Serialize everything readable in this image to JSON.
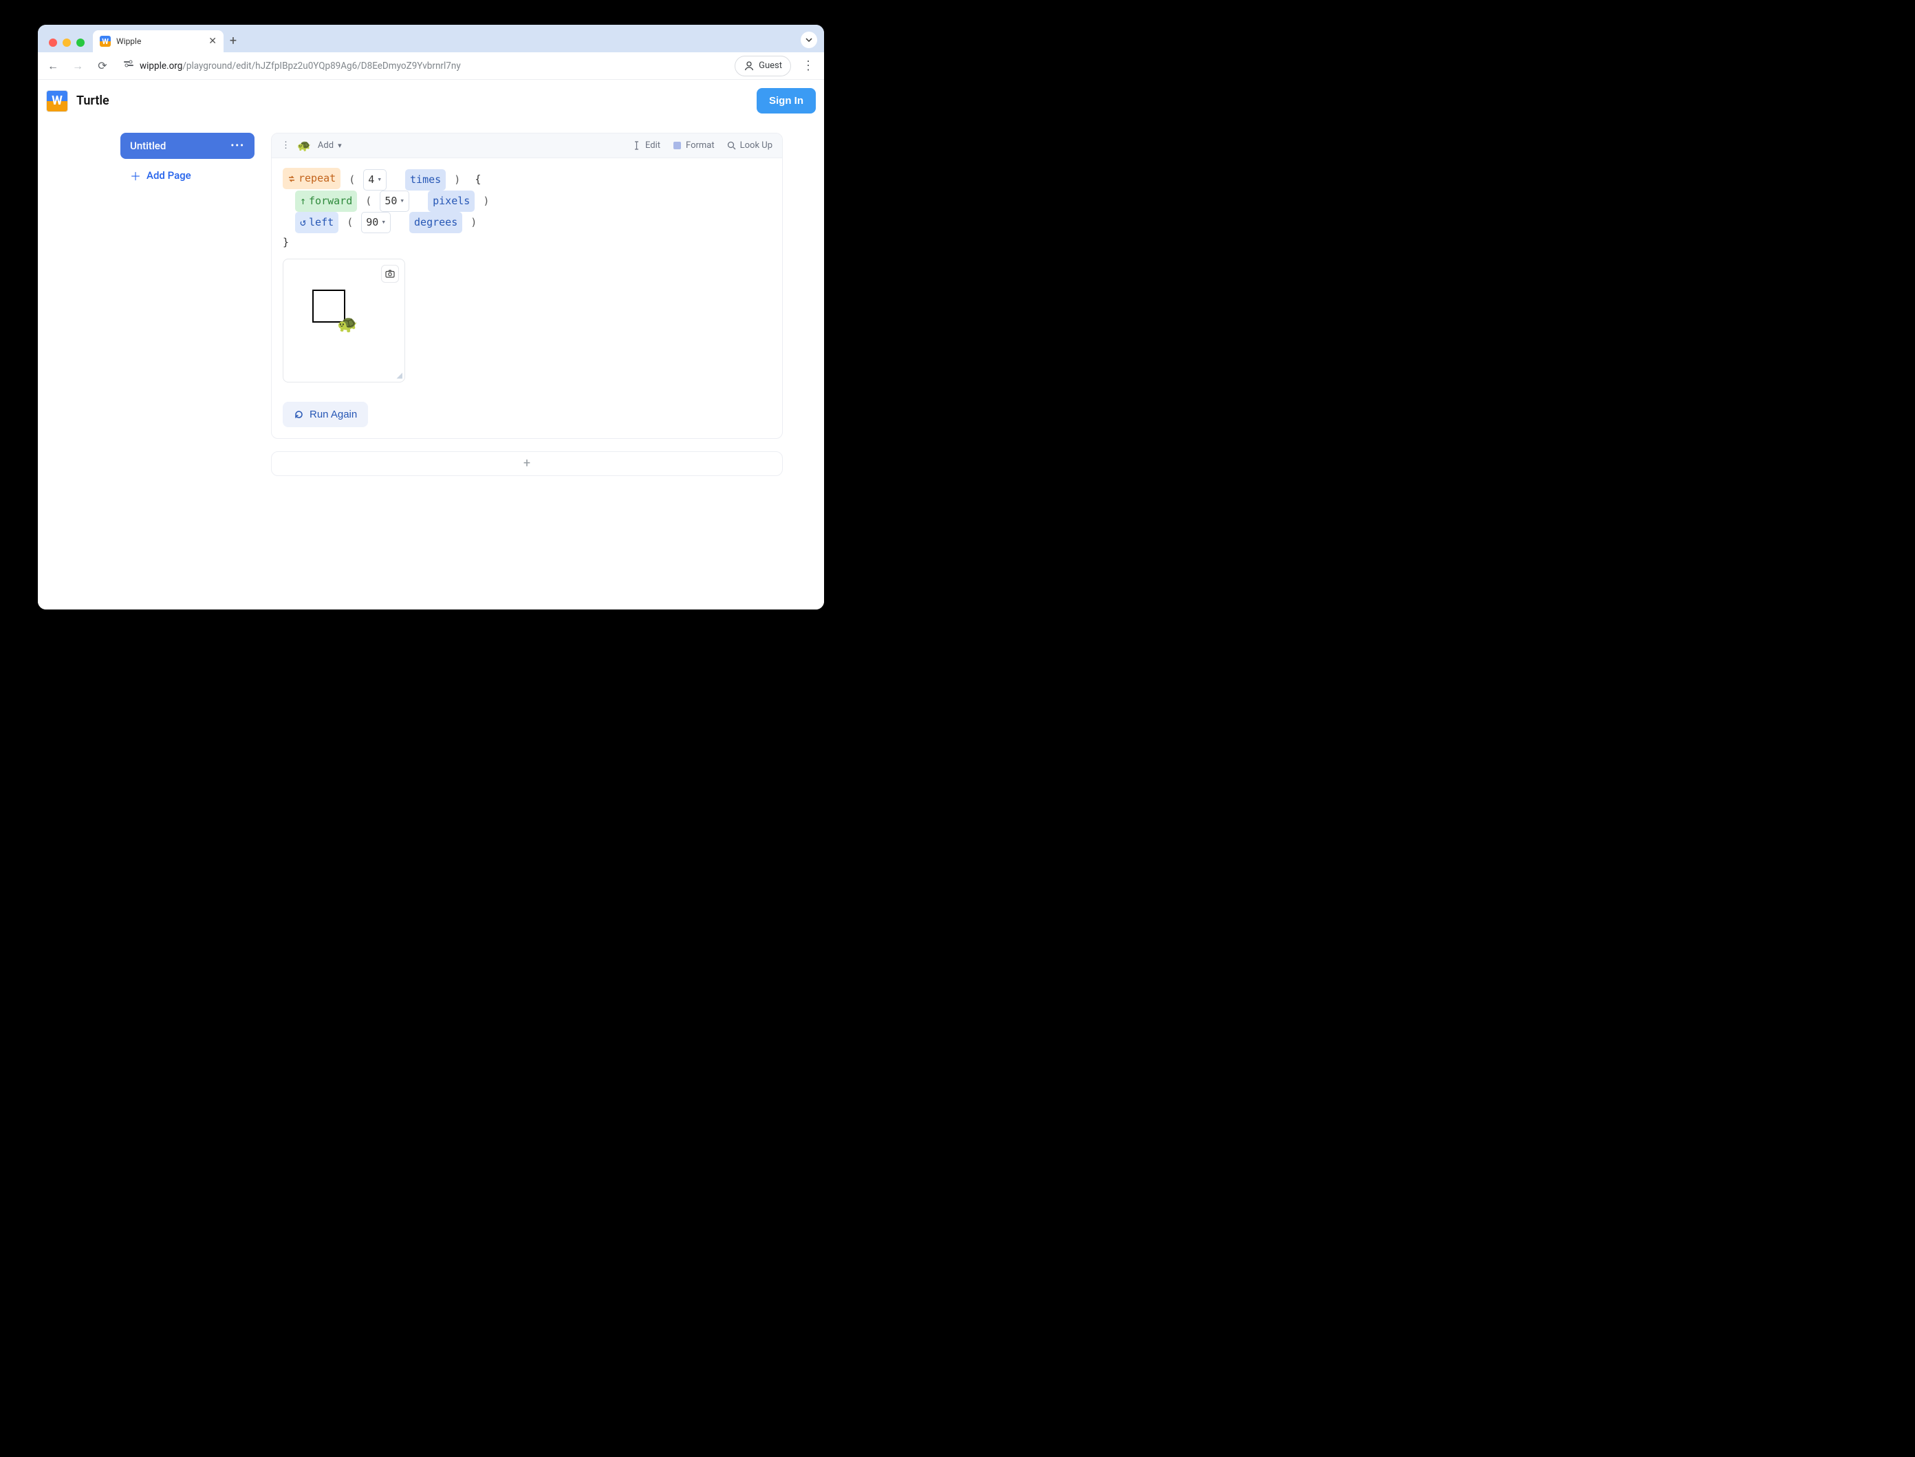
{
  "browser": {
    "tab_title": "Wipple",
    "url_host": "wipple.org",
    "url_path": "/playground/edit/hJZfpIBpz2u0YQp89Ag6/D8EeDmyoZ9Yvbrnrl7ny",
    "guest_label": "Guest"
  },
  "app": {
    "title": "Turtle",
    "signin_label": "Sign In"
  },
  "sidebar": {
    "page_label": "Untitled",
    "add_page_label": "Add Page"
  },
  "editor_toolbar": {
    "add_label": "Add",
    "edit_label": "Edit",
    "format_label": "Format",
    "lookup_label": "Look Up"
  },
  "code": {
    "repeat_label": "repeat",
    "repeat_value": "4",
    "times_label": "times",
    "forward_label": "forward",
    "forward_value": "50",
    "pixels_label": "pixels",
    "left_label": "left",
    "left_value": "90",
    "degrees_label": "degrees",
    "open_brace": "{",
    "close_brace": "}"
  },
  "run_label": "Run Again"
}
